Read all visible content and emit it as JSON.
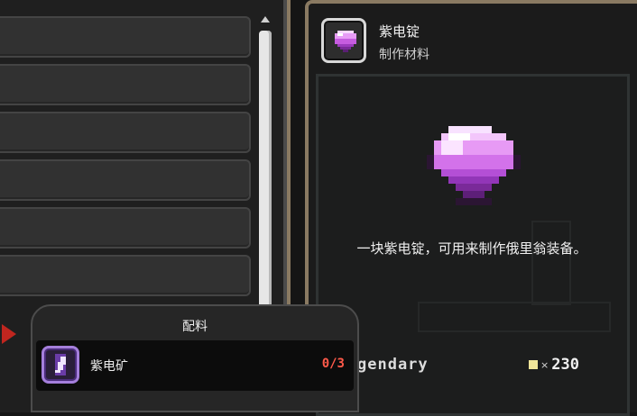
{
  "item": {
    "name": "紫电锭",
    "category": "制作材料",
    "description": "一块紫电锭，可用来制作俄里翁装备。",
    "rarity_text": "gendary",
    "price_x": "×",
    "price": "230",
    "icon": "purple-gem-icon"
  },
  "ingredients": {
    "title": "配料",
    "items": [
      {
        "name": "紫电矿",
        "count": "0/3",
        "icon": "lightning-ore-icon"
      }
    ]
  },
  "colors": {
    "count_insufficient": "#ff5a4a",
    "frame_gold": "#8a7a62",
    "gem_purple": "#d070e8"
  }
}
